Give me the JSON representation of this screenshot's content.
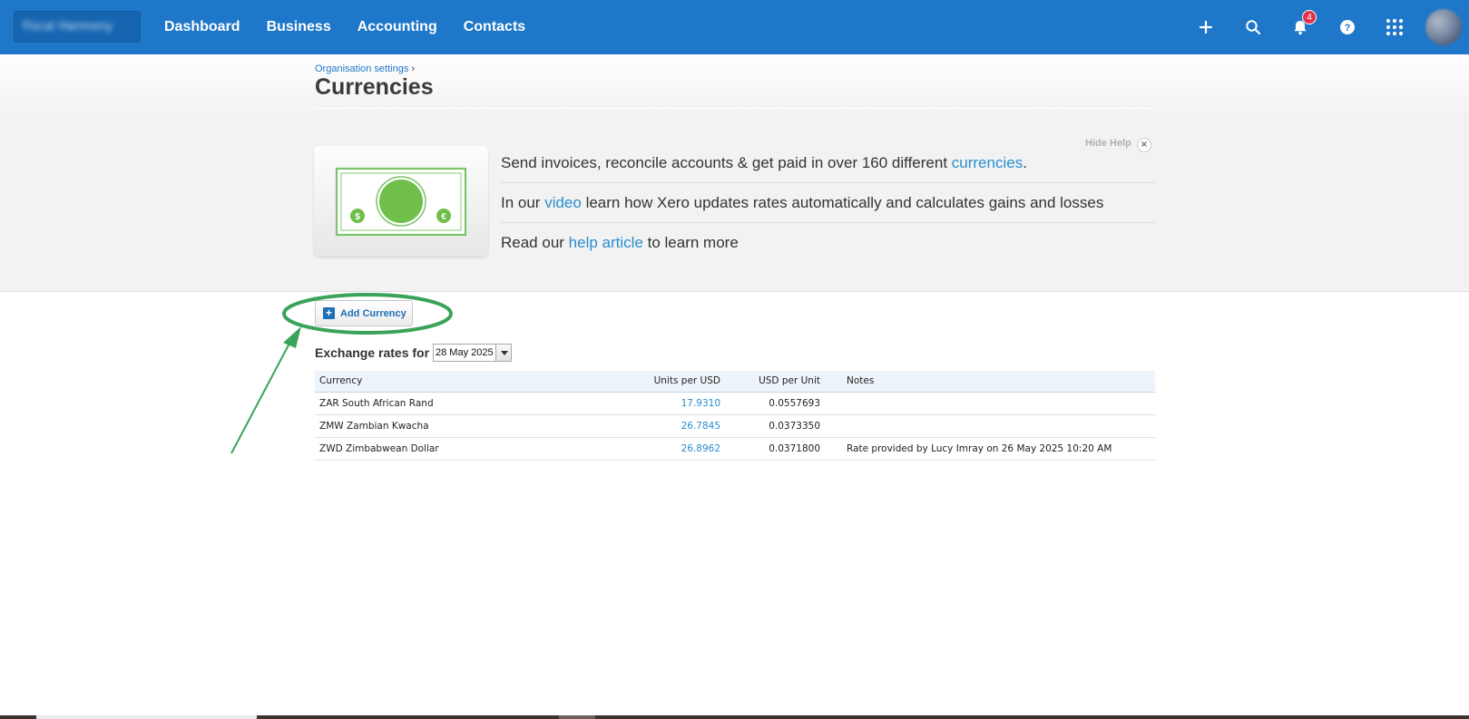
{
  "topbar": {
    "org_name": "Fiscal Harmony",
    "nav": [
      "Dashboard",
      "Business",
      "Accounting",
      "Contacts"
    ],
    "notification_count": "4",
    "icons": [
      "plus-icon",
      "search-icon",
      "bell-icon",
      "help-icon",
      "apps-grid-icon",
      "avatar"
    ]
  },
  "breadcrumb": {
    "parent": "Organisation settings",
    "separator": "›"
  },
  "page": {
    "title": "Currencies"
  },
  "help": {
    "hide_label": "Hide Help",
    "line1_pre": "Send invoices, reconcile accounts & get paid in over 160 different ",
    "line1_link": "currencies",
    "line1_post": ".",
    "line2_pre": "In our ",
    "line2_link": "video",
    "line2_post": " learn how Xero updates rates automatically and calculates gains and losses",
    "line3_pre": "Read our ",
    "line3_link": "help article",
    "line3_post": " to learn more"
  },
  "actions": {
    "add_currency": "Add Currency"
  },
  "rates": {
    "label": "Exchange rates for",
    "date": "28 May 2025",
    "columns": [
      "Currency",
      "Units per USD",
      "USD per Unit",
      "Notes"
    ],
    "rows": [
      {
        "currency": "ZAR South African Rand",
        "units_per_usd": "17.9310",
        "usd_per_unit": "0.0557693",
        "notes": ""
      },
      {
        "currency": "ZMW Zambian Kwacha",
        "units_per_usd": "26.7845",
        "usd_per_unit": "0.0373350",
        "notes": ""
      },
      {
        "currency": "ZWD Zimbabwean Dollar",
        "units_per_usd": "26.8962",
        "usd_per_unit": "0.0371800",
        "notes": "Rate provided by Lucy Imray on 26 May 2025 10:20 AM"
      }
    ]
  },
  "colors": {
    "brand": "#1e77c8",
    "link": "#2a8dcf",
    "annotation": "#3aa35a",
    "badge": "#e0314a"
  }
}
